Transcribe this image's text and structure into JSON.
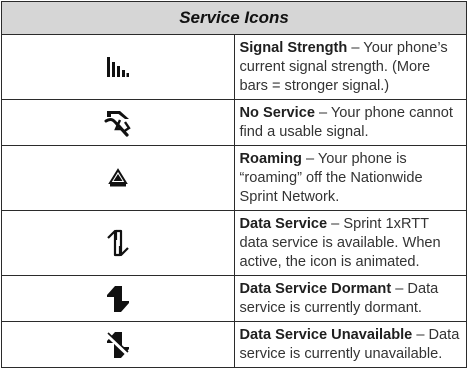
{
  "table": {
    "title": "Service Icons",
    "rows": [
      {
        "icon": "signal-strength-icon",
        "term": "Signal Strength",
        "desc": " – Your phone’s current signal strength. (More bars = stronger signal.)"
      },
      {
        "icon": "no-service-icon",
        "term": "No Service",
        "desc": " – Your phone cannot find a usable signal."
      },
      {
        "icon": "roaming-icon",
        "term": "Roaming",
        "desc": " – Your phone is “roaming” off the Nationwide Sprint Network."
      },
      {
        "icon": "data-service-icon",
        "term": "Data Service",
        "desc": " – Sprint 1xRTT data service is available. When active, the icon is animated."
      },
      {
        "icon": "data-service-dormant-icon",
        "term": "Data Service Dormant",
        "desc": " – Data service is currently dormant."
      },
      {
        "icon": "data-service-unavailable-icon",
        "term": "Data Service Unavailable",
        "desc": " – Data service is currently unavailable."
      }
    ]
  }
}
